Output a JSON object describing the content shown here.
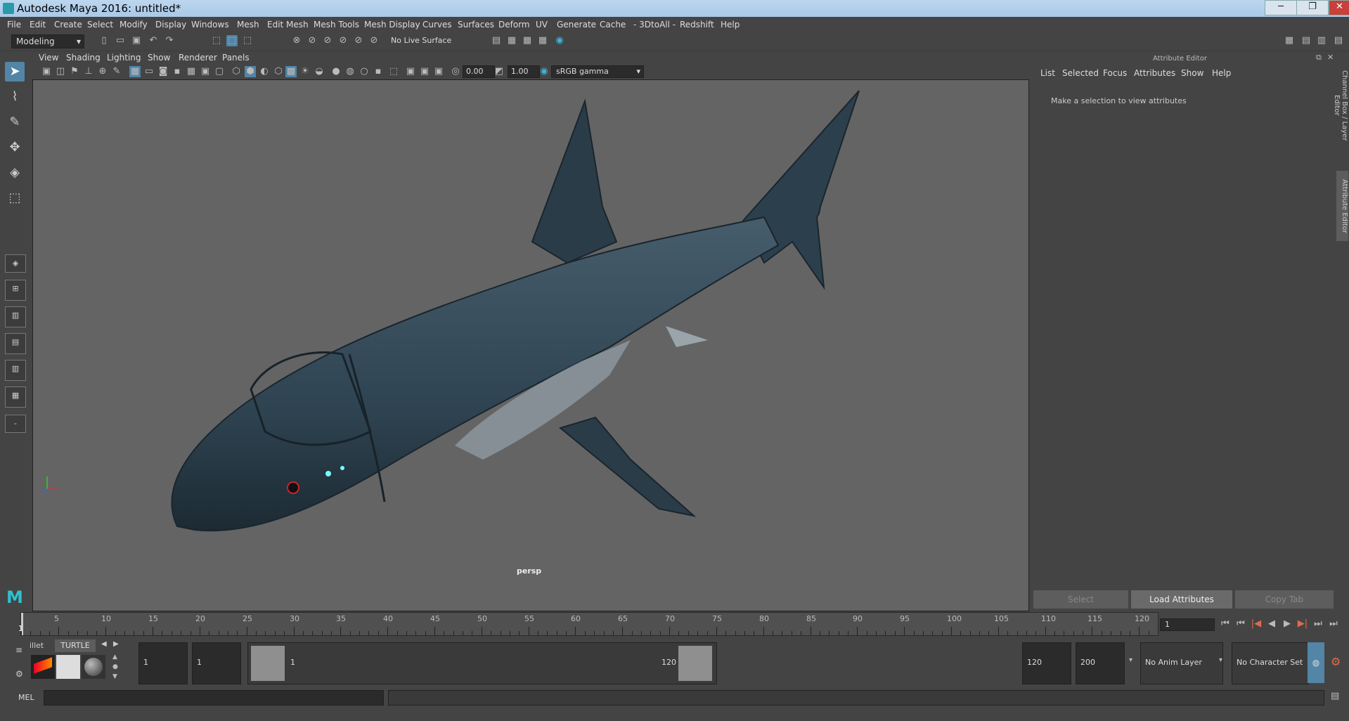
{
  "window": {
    "title": "Autodesk Maya 2016: untitled*",
    "controls": {
      "minimize": "─",
      "maximize": "❐",
      "close": "✕"
    }
  },
  "menubar": {
    "items": [
      "File",
      "Edit",
      "Create",
      "Select",
      "Modify",
      "Display",
      "Windows",
      "Mesh",
      "Edit Mesh",
      "Mesh Tools",
      "Mesh Display",
      "Curves",
      "Surfaces",
      "Deform",
      "UV",
      "Generate",
      "Cache",
      "- 3DtoAll -",
      "Redshift",
      "Help"
    ]
  },
  "toolbar": {
    "mode": "Modeling",
    "live_surface": "No Live Surface"
  },
  "viewport": {
    "menu": [
      "View",
      "Shading",
      "Lighting",
      "Show",
      "Renderer",
      "Panels"
    ],
    "exposure": "0.00",
    "gamma": "1.00",
    "color_space": "sRGB gamma",
    "camera": "persp",
    "background_color": "#646464",
    "model_color": "#2f4452"
  },
  "attribute_editor": {
    "header": "Attribute Editor",
    "menu": [
      "List",
      "Selected",
      "Focus",
      "Attributes",
      "Show",
      "Help"
    ],
    "message": "Make a selection to view attributes",
    "buttons": {
      "select": "Select",
      "load": "Load Attributes",
      "copy": "Copy Tab"
    },
    "side_tabs": [
      "Channel Box / Layer Editor",
      "Attribute Editor"
    ]
  },
  "timeline": {
    "ticks": [
      "5",
      "10",
      "15",
      "20",
      "25",
      "30",
      "35",
      "40",
      "45",
      "50",
      "55",
      "60",
      "65",
      "70",
      "75",
      "80",
      "85",
      "90",
      "95",
      "100",
      "105",
      "110",
      "115",
      "120"
    ],
    "first_label": "1",
    "current_frame": "1",
    "playback": [
      "⏮",
      "⏮",
      "|◀",
      "◀",
      "▶",
      "▶|",
      "⏭",
      "⏭"
    ]
  },
  "range": {
    "shelf_tabs": [
      "illet",
      "TURTLE"
    ],
    "start": "1",
    "anim_start": "1",
    "slider_start": "1",
    "slider_end": "120",
    "end": "120",
    "anim_end": "200",
    "anim_layer": "No Anim Layer",
    "character_set": "No Character Set"
  },
  "command_line": {
    "label": "MEL"
  }
}
